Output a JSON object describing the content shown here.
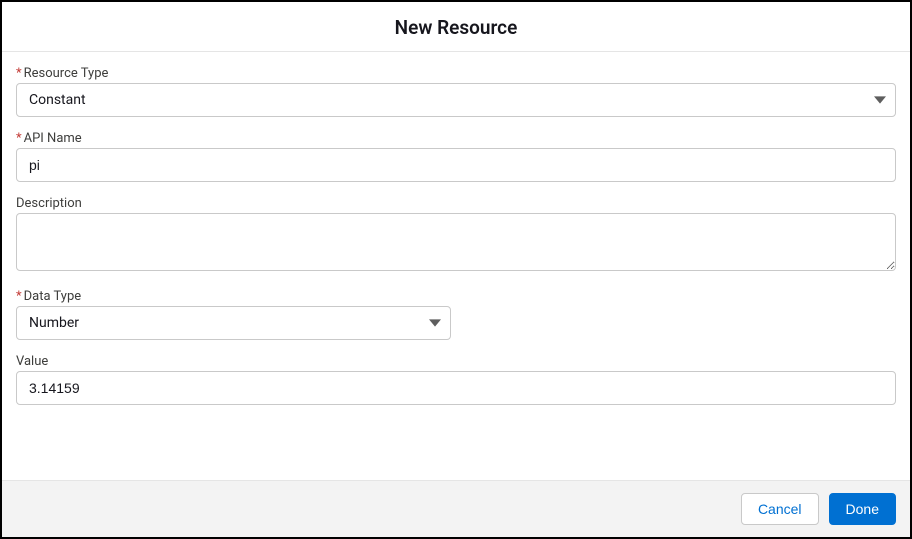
{
  "header": {
    "title": "New Resource"
  },
  "form": {
    "resourceType": {
      "label": "Resource Type",
      "required": true,
      "value": "Constant"
    },
    "apiName": {
      "label": "API Name",
      "required": true,
      "value": "pi"
    },
    "description": {
      "label": "Description",
      "required": false,
      "value": ""
    },
    "dataType": {
      "label": "Data Type",
      "required": true,
      "value": "Number"
    },
    "value": {
      "label": "Value",
      "required": false,
      "value": "3.14159"
    }
  },
  "footer": {
    "cancel": "Cancel",
    "done": "Done"
  },
  "requiredMarker": "*"
}
